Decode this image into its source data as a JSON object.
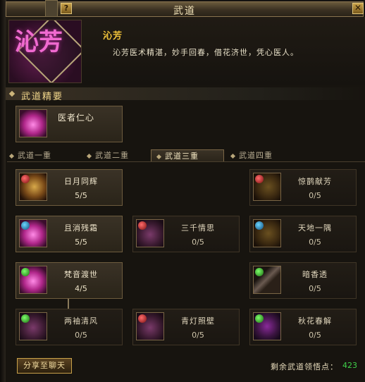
{
  "window": {
    "title": "武道",
    "help_label": "?",
    "close_label": "✕"
  },
  "school": {
    "portrait_text": "沁芳",
    "name": "沁芳",
    "description": "沁芳医术精湛，妙手回春，借花济世，凭心医人。"
  },
  "essentials": {
    "title": "武道精要",
    "featured_skill": {
      "name": "医者仁心",
      "icon": "lotus-heal-icon"
    }
  },
  "tabs": [
    {
      "label": "武道一重",
      "active": false
    },
    {
      "label": "武道二重",
      "active": false
    },
    {
      "label": "武道三重",
      "active": true
    },
    {
      "label": "武道四重",
      "active": false
    }
  ],
  "skills": [
    {
      "name": "日月同辉",
      "level": "5/5",
      "badge": "red",
      "icon": "sun-moon-icon"
    },
    {
      "name": "惊鹊献芳",
      "level": "0/5",
      "badge": "red",
      "icon": "magpie-icon"
    },
    {
      "name": "且消残霜",
      "level": "5/5",
      "badge": "blue",
      "icon": "frost-icon"
    },
    {
      "name": "三千情思",
      "level": "0/5",
      "badge": "red",
      "icon": "thought-icon"
    },
    {
      "name": "天地一隅",
      "level": "0/5",
      "badge": "blue",
      "icon": "corner-icon"
    },
    {
      "name": "梵音渡世",
      "level": "4/5",
      "badge": "green",
      "icon": "sanskrit-icon"
    },
    {
      "name": "暗香透",
      "level": "0/5",
      "badge": "green",
      "icon": "fragrance-icon"
    },
    {
      "name": "两袖清风",
      "level": "0/5",
      "badge": "green",
      "icon": "breeze-icon"
    },
    {
      "name": "青灯照壁",
      "level": "0/5",
      "badge": "red",
      "icon": "lamp-icon"
    },
    {
      "name": "秋花春解",
      "level": "0/5",
      "badge": "green",
      "icon": "flower-icon"
    }
  ],
  "footer": {
    "share_label": "分享至聊天",
    "points_label": "剩余武道领悟点：",
    "points_value": "423"
  },
  "colors": {
    "accent": "#f0c23a",
    "points": "#3fd24a",
    "frame": "#6e5c3e"
  }
}
